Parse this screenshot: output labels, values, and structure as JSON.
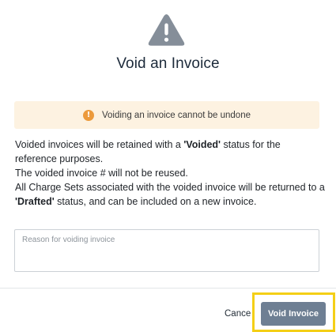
{
  "dialog": {
    "title": "Void an Invoice",
    "icon": "warning-triangle-icon",
    "alert": {
      "icon": "exclamation-circle-icon",
      "text": "Voiding an invoice cannot be undone",
      "color": "#ec9a3c",
      "background": "#fdf2e1"
    },
    "body": {
      "p1_before": "Voided invoices will be retained with a ",
      "p1_bold": "'Voided'",
      "p1_after": " status for the reference purposes.",
      "p2": "The voided invoice # will not be reused.",
      "p3_before": "All Charge Sets associated with the voided invoice will be returned to a ",
      "p3_bold": "'Drafted'",
      "p3_after": " status, and can be included on a new invoice."
    },
    "reason": {
      "placeholder": "Reason for voiding invoice",
      "value": ""
    },
    "footer": {
      "cancel_label": "Cancel",
      "void_label": "Void Invoice",
      "void_color": "#6e7f93",
      "highlight_color": "#f4cf16"
    }
  }
}
